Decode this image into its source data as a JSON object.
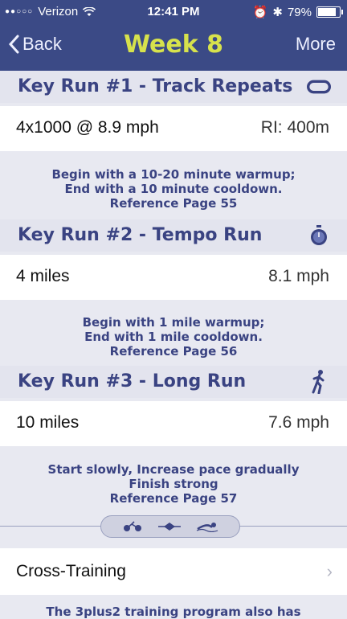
{
  "status": {
    "carrier": "Verizon",
    "time": "12:41 PM",
    "battery": "79%",
    "battery_level": 0.79
  },
  "nav": {
    "back": "Back",
    "title": "Week 8",
    "more": "More"
  },
  "runs": [
    {
      "title": "Key Run #1 - Track Repeats",
      "left": "4x1000 @ 8.9 mph",
      "right": "RI: 400m",
      "note": [
        "Begin with a 10-20 minute warmup;",
        "End with a 10 minute cooldown.",
        "Reference Page 55"
      ]
    },
    {
      "title": "Key Run #2 - Tempo Run",
      "left": "4 miles",
      "right": "8.1 mph",
      "note": [
        "Begin with 1 mile warmup;",
        "End with 1 mile cooldown.",
        "Reference Page 56"
      ]
    },
    {
      "title": "Key Run #3 - Long Run",
      "left": "10 miles",
      "right": "7.6 mph",
      "note": [
        "Start slowly, Increase pace gradually",
        "Finish strong",
        "Reference Page 57"
      ]
    }
  ],
  "cross_training": {
    "label": "Cross-Training"
  },
  "footer_note": "The 3plus2 training program also has"
}
